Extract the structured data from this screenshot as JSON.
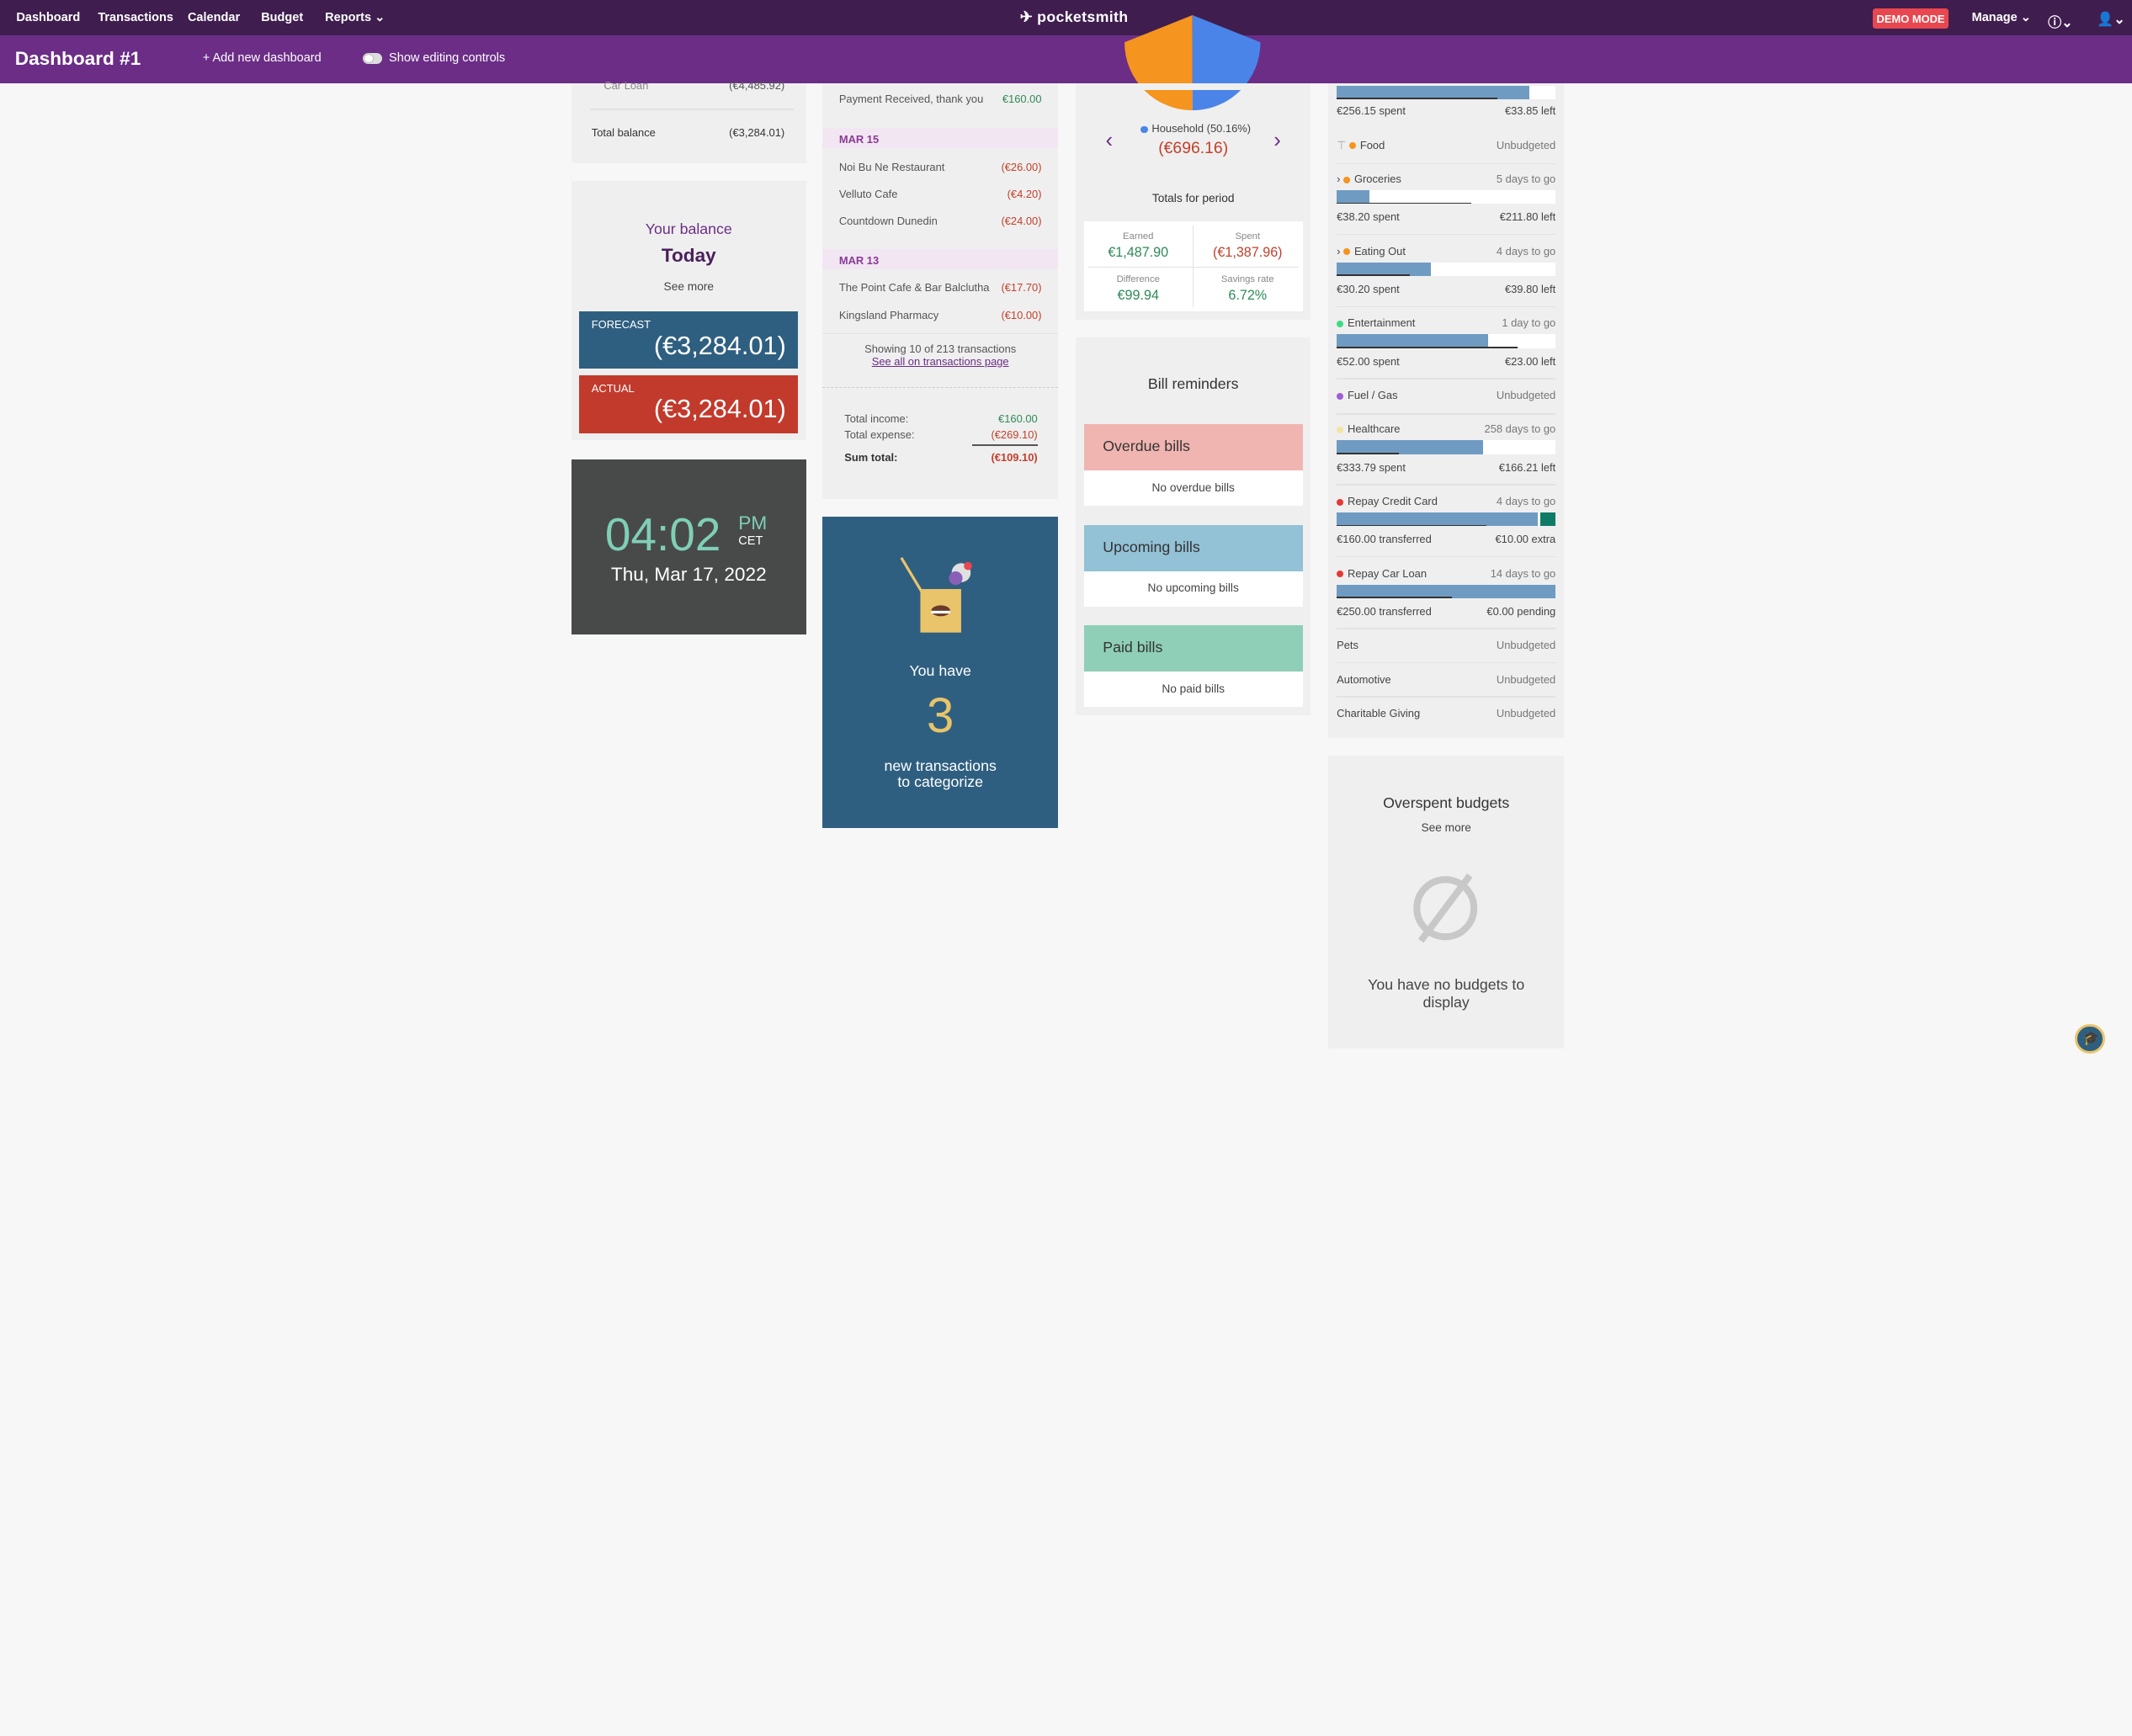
{
  "nav": {
    "items": [
      "Dashboard",
      "Transactions",
      "Calendar",
      "Budget",
      "Reports"
    ],
    "logo": "pocketsmith",
    "demo": "DEMO MODE",
    "manage": "Manage"
  },
  "subnav": {
    "title": "Dashboard #1",
    "add": "Add new dashboard",
    "edit": "Show editing controls"
  },
  "accounts": {
    "car_loan": "Car Loan",
    "car_loan_amt": "(€4,485.92)",
    "total_label": "Total balance",
    "total_amt": "(€3,284.01)"
  },
  "balance": {
    "title": "Your balance",
    "today": "Today",
    "see_more": "See more",
    "forecast_label": "FORECAST",
    "forecast_amt": "(€3,284.01)",
    "actual_label": "ACTUAL",
    "actual_amt": "(€3,284.01)"
  },
  "clock": {
    "time": "04:02",
    "ampm": "PM",
    "tz": "CET",
    "date": "Thu, Mar 17, 2022"
  },
  "transactions": {
    "first": {
      "name": "Payment Received, thank you",
      "amt": "€160.00"
    },
    "groups": [
      {
        "date": "MAR 15",
        "rows": [
          {
            "name": "Noi Bu Ne Restaurant",
            "amt": "(€26.00)"
          },
          {
            "name": "Velluto Cafe",
            "amt": "(€4.20)"
          },
          {
            "name": "Countdown Dunedin",
            "amt": "(€24.00)"
          }
        ]
      },
      {
        "date": "MAR 13",
        "rows": [
          {
            "name": "The Point Cafe & Bar Balclutha",
            "amt": "(€17.70)"
          },
          {
            "name": "Kingsland Pharmacy",
            "amt": "(€10.00)"
          }
        ]
      }
    ],
    "showing": "Showing 10 of 213 transactions",
    "see_all": "See all on transactions page",
    "income_label": "Total income:",
    "income": "€160.00",
    "expense_label": "Total expense:",
    "expense": "(€269.10)",
    "sum_label": "Sum total:",
    "sum": "(€109.10)"
  },
  "uncat": {
    "you_have": "You have",
    "count": "3",
    "line1": "new transactions",
    "line2": "to categorize"
  },
  "pie": {
    "legend": "Household (50.16%)",
    "amount": "(€696.16)",
    "totals_title": "Totals for period",
    "earned_label": "Earned",
    "earned": "€1,487.90",
    "spent_label": "Spent",
    "spent": "(€1,387.96)",
    "diff_label": "Difference",
    "diff": "€99.94",
    "savings_label": "Savings rate",
    "savings": "6.72%",
    "colors": {
      "household": "#4a84e8",
      "other": "#f5941e"
    }
  },
  "bills": {
    "title": "Bill reminders",
    "overdue": "Overdue bills",
    "overdue_none": "No overdue bills",
    "upcoming": "Upcoming bills",
    "upcoming_none": "No upcoming bills",
    "paid": "Paid bills",
    "paid_none": "No paid bills"
  },
  "budgets": {
    "top_spent": "€256.15 spent",
    "top_left": "€33.85 left",
    "top_progress": 0.88,
    "food": {
      "name": "Food",
      "status": "Unbudgeted"
    },
    "groceries": {
      "name": "Groceries",
      "status": "5 days to go",
      "spent": "€38.20 spent",
      "left": "€211.80 left",
      "progress": 0.15
    },
    "eating": {
      "name": "Eating Out",
      "status": "4 days to go",
      "spent": "€30.20 spent",
      "left": "€39.80 left",
      "progress": 0.43
    },
    "ent": {
      "name": "Entertainment",
      "status": "1 day to go",
      "spent": "€52.00 spent",
      "left": "€23.00 left",
      "progress": 0.69
    },
    "fuel": {
      "name": "Fuel / Gas",
      "status": "Unbudgeted"
    },
    "health": {
      "name": "Healthcare",
      "status": "258 days to go",
      "spent": "€333.79 spent",
      "left": "€166.21 left",
      "progress": 0.67
    },
    "repaycc": {
      "name": "Repay Credit Card",
      "status": "4 days to go",
      "spent": "€160.00 transferred",
      "left": "€10.00 extra",
      "progress": 0.92
    },
    "repaycar": {
      "name": "Repay Car Loan",
      "status": "14 days to go",
      "spent": "€250.00 transferred",
      "left": "€0.00 pending",
      "progress": 1.0
    },
    "pets": {
      "name": "Pets",
      "status": "Unbudgeted"
    },
    "auto": {
      "name": "Automotive",
      "status": "Unbudgeted"
    },
    "charity": {
      "name": "Charitable Giving",
      "status": "Unbudgeted"
    }
  },
  "overspent": {
    "title": "Overspent budgets",
    "see_more": "See more",
    "empty1": "You have no budgets to",
    "empty2": "display"
  }
}
